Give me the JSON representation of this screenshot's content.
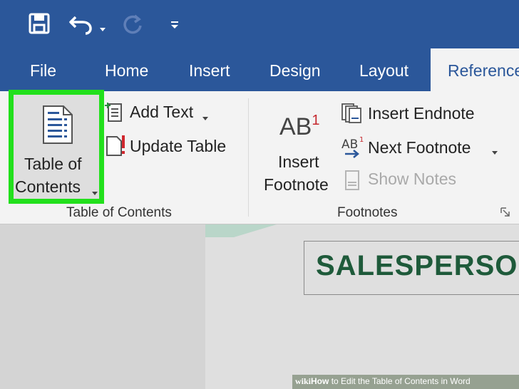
{
  "quick_access": {
    "save_icon": "save-icon",
    "undo_icon": "undo-icon",
    "redo_icon": "redo-icon",
    "customize_icon": "customize-qat-icon"
  },
  "tabs": {
    "file": "File",
    "home": "Home",
    "insert": "Insert",
    "design": "Design",
    "layout": "Layout",
    "references": "Reference"
  },
  "ribbon": {
    "toc_group": {
      "toc_button_line1": "Table of",
      "toc_button_line2": "Contents",
      "add_text": "Add Text",
      "update_table": "Update Table",
      "label": "Table of Contents"
    },
    "footnotes_group": {
      "insert_footnote_line1": "Insert",
      "insert_footnote_line2": "Footnote",
      "ab_glyph": "AB",
      "ab_superscript": "1",
      "insert_endnote": "Insert Endnote",
      "next_footnote": "Next Footnote",
      "show_notes": "Show Notes",
      "label": "Footnotes"
    }
  },
  "document": {
    "heading": "SALESPERSON"
  },
  "watermark": {
    "brand": "wiki",
    "bold": "How",
    "text": " to Edit the Table of Contents in Word"
  },
  "colors": {
    "title_bar": "#2b579a",
    "ribbon": "#f3f3f3",
    "highlight": "#22e01c",
    "heading": "#1e5a3a"
  }
}
